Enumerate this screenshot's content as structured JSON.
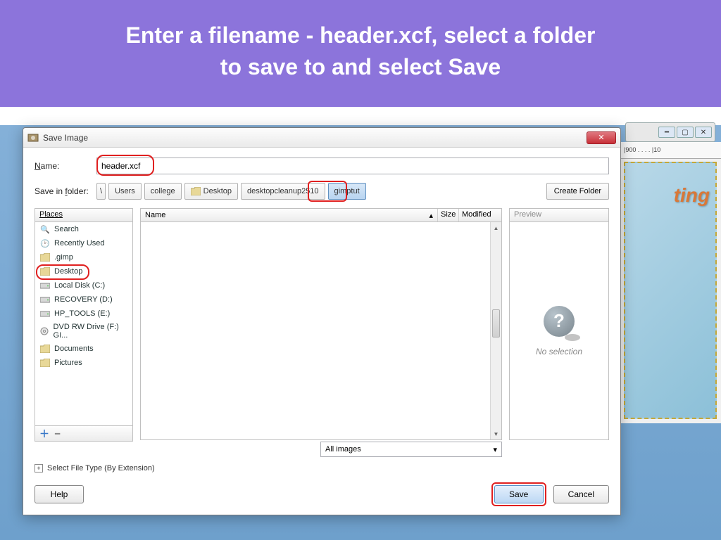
{
  "banner": {
    "line1": "Enter a filename - header.xcf, select a folder",
    "line2": "to save to and select Save"
  },
  "dialog": {
    "title": "Save Image",
    "name_label": "Name:",
    "filename": "header.xcf",
    "folder_label": "Save in folder:",
    "breadcrumbs": [
      "Users",
      "college",
      "Desktop",
      "desktopcleanup2510",
      "gimptut"
    ],
    "create_folder": "Create Folder",
    "places_header": "Places",
    "places": [
      {
        "label": "Search",
        "icon": "search"
      },
      {
        "label": "Recently Used",
        "icon": "recent"
      },
      {
        "label": ".gimp",
        "icon": "folder"
      },
      {
        "label": "Desktop",
        "icon": "folder"
      },
      {
        "label": "Local Disk (C:)",
        "icon": "drive"
      },
      {
        "label": "RECOVERY (D:)",
        "icon": "drive"
      },
      {
        "label": "HP_TOOLS (E:)",
        "icon": "drive"
      },
      {
        "label": "DVD RW Drive (F:) GI...",
        "icon": "optical"
      },
      {
        "label": "Documents",
        "icon": "folder"
      },
      {
        "label": "Pictures",
        "icon": "folder"
      }
    ],
    "cols": {
      "name": "Name",
      "size": "Size",
      "modified": "Modified"
    },
    "preview_header": "Preview",
    "no_selection": "No selection",
    "filetype": "All images",
    "ext_label": "Select File Type (By Extension)",
    "help": "Help",
    "save": "Save",
    "cancel": "Cancel"
  },
  "background": {
    "ruler_marks": "|900 . . . . |10",
    "canvas_text": "ting"
  }
}
